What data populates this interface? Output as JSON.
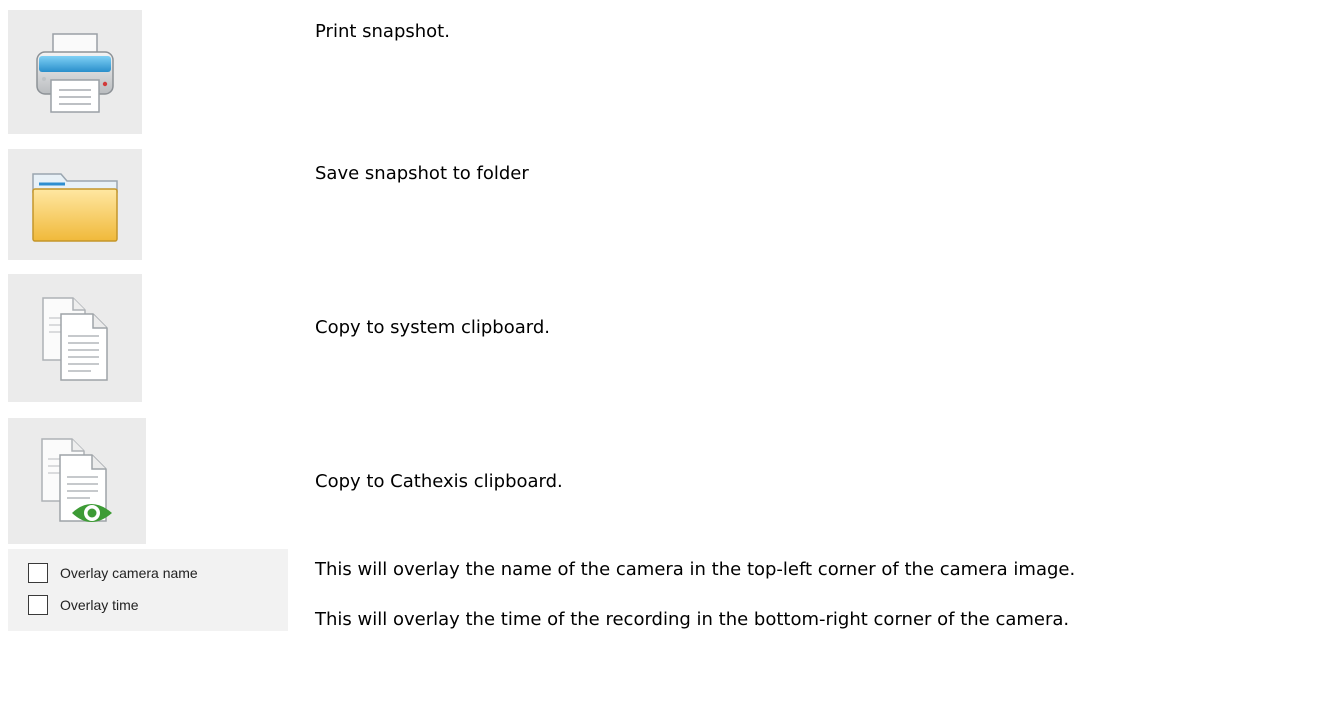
{
  "actions": [
    {
      "icon": "printer-icon",
      "text": "Print snapshot."
    },
    {
      "icon": "folder-icon",
      "text": "Save snapshot to folder"
    },
    {
      "icon": "copy-documents-icon",
      "text": "Copy to system clipboard."
    },
    {
      "icon": "copy-with-eye-icon",
      "text": "Copy to Cathexis clipboard."
    }
  ],
  "options": {
    "overlay_camera_name": {
      "label": "Overlay camera name",
      "checked": false
    },
    "overlay_time": {
      "label": "Overlay time",
      "checked": false
    }
  },
  "descriptions": {
    "overlay_camera_name": "This will overlay the name of the camera in the top-left corner of the camera image.",
    "overlay_time": "This will overlay the time of the recording in the bottom-right corner of the camera."
  },
  "colors": {
    "tile_background": "#ebebeb",
    "folder_yellow": "#f5c94a",
    "printer_blue": "#3aa6dc",
    "eye_green": "#3d9b35"
  }
}
